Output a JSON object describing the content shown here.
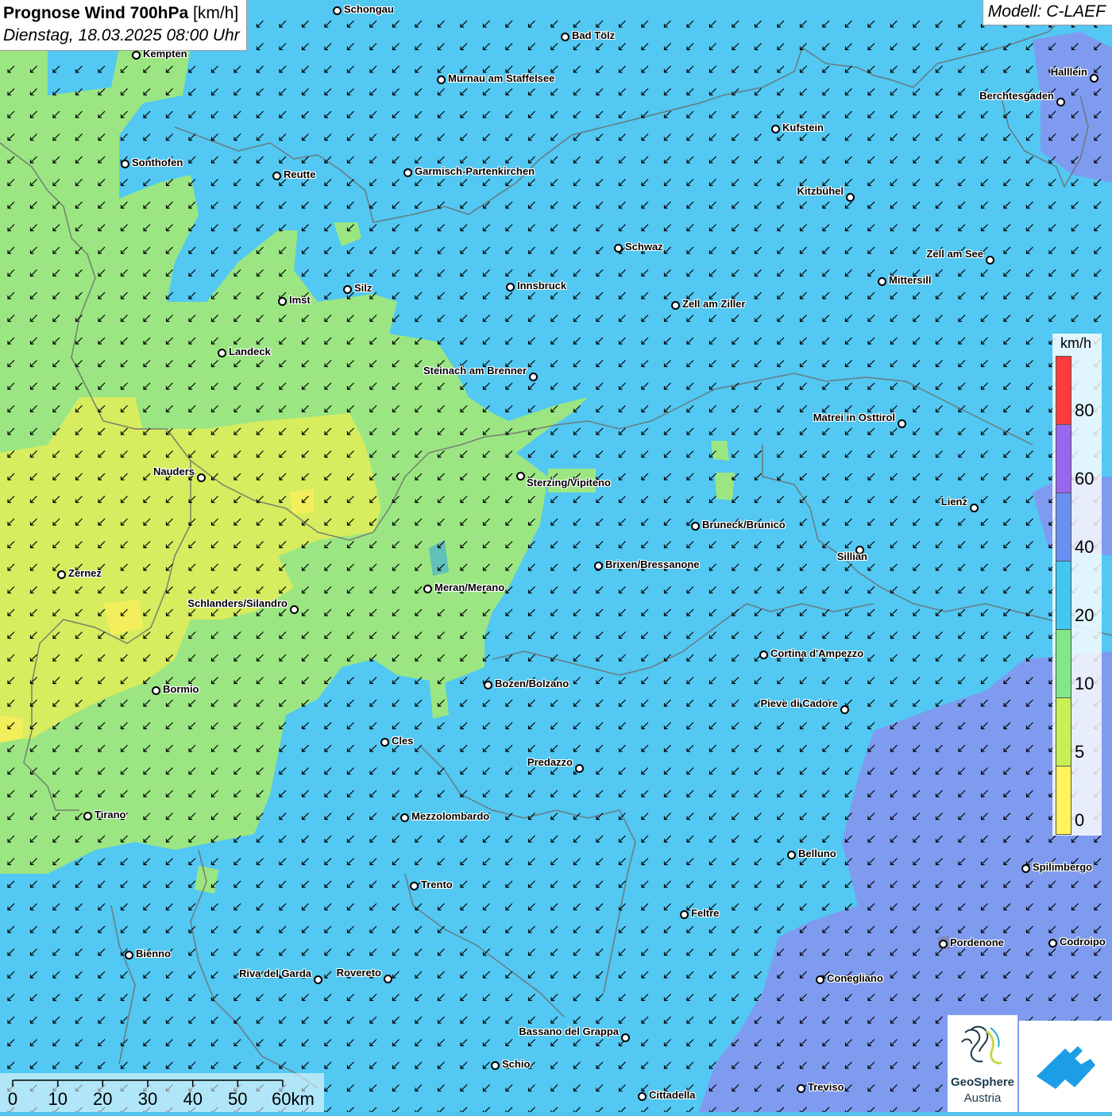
{
  "header": {
    "title_bold": "Prognose Wind 700hPa",
    "title_unit": "[km/h]",
    "datetime": "Dienstag, 18.03.2025 08:00 Uhr"
  },
  "model": "Modell: C-LAEF",
  "cities": [
    "Schongau",
    "Bad Tölz",
    "Kempten",
    "Murnau am Staffelsee",
    "Halllein",
    "Berchtesgaden",
    "Kufstein",
    "Sonthofen",
    "Reutte",
    "Garmisch-Partenkirchen",
    "Kitzbühel",
    "Schwaz",
    "Zell am See",
    "Mittersill",
    "Innsbruck",
    "Silz",
    "Imst",
    "Zell am Ziller",
    "Landeck",
    "Steinach am Brenner",
    "Matrei in Osttirol",
    "Sterzing/Vipiteno",
    "Nauders",
    "Lienz",
    "Bruneck/Brunico",
    "Sillian",
    "Brixen/Bressanone",
    "Zernez",
    "Meran/Merano",
    "Schlanders/Silandro",
    "Cortina d'Ampezzo",
    "Bozen/Bolzano",
    "Bormio",
    "Pieve di Cadore",
    "Cles",
    "Predazzo",
    "Tirano",
    "Mezzolombardo",
    "Belluno",
    "Spilimbergo",
    "Trento",
    "Feltre",
    "Bienno",
    "Pordenone",
    "Codroipo",
    "Riva del Garda",
    "Rovereto",
    "Conegliano",
    "Bassano del Grappa",
    "Schio",
    "Treviso",
    "Cittadella"
  ],
  "legend": {
    "unit": "km/h",
    "labels": [
      "80",
      "60",
      "40",
      "20",
      "10",
      "5",
      "0"
    ],
    "colors": [
      "#ff3b3b",
      "#9966ee",
      "#6a8ff2",
      "#3ec8f2",
      "#7ee88a",
      "#c8f055",
      "#fff45a"
    ]
  },
  "scale": {
    "labels": [
      "0",
      "10",
      "20",
      "30",
      "40",
      "50",
      "60km"
    ]
  },
  "logo": {
    "name": "GeoSphere",
    "sub": "Austria"
  },
  "wind": {
    "direction": "from north-east",
    "field_colors": {
      "blue": "#52c8f2",
      "green": "#9be682",
      "yellow": "#d7ec5e",
      "purple": "#7f9bf0"
    }
  }
}
